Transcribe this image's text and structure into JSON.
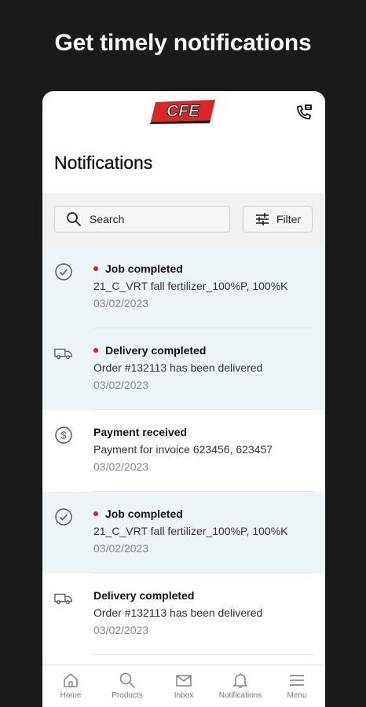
{
  "promo": {
    "headline": "Get timely notifications"
  },
  "app": {
    "logo_text": "CFE",
    "page_title": "Notifications",
    "search": {
      "label": "Search"
    },
    "filter": {
      "label": "Filter"
    }
  },
  "colors": {
    "unread_bg": "#eef5f8",
    "unread_dot": "#e02020",
    "logo_red": "#d8262b"
  },
  "notifications": [
    {
      "icon": "check-circle-icon",
      "unread": true,
      "title": "Job completed",
      "description": "21_C_VRT fall fertilizer_100%P, 100%K",
      "date": "03/02/2023"
    },
    {
      "icon": "truck-icon",
      "unread": true,
      "title": "Delivery completed",
      "description": "Order #132113 has been delivered",
      "date": "03/02/2023"
    },
    {
      "icon": "dollar-circle-icon",
      "unread": false,
      "title": "Payment received",
      "description": "Payment for invoice 623456, 623457",
      "date": "03/02/2023"
    },
    {
      "icon": "check-circle-icon",
      "unread": true,
      "title": "Job completed",
      "description": "21_C_VRT fall fertilizer_100%P, 100%K",
      "date": "03/02/2023"
    },
    {
      "icon": "truck-icon",
      "unread": false,
      "title": "Delivery completed",
      "description": "Order #132113 has been delivered",
      "date": "03/02/2023"
    }
  ],
  "nav": {
    "home": "Home",
    "products": "Products",
    "inbox": "Inbox",
    "notifications": "Notifications",
    "menu": "Menu"
  }
}
